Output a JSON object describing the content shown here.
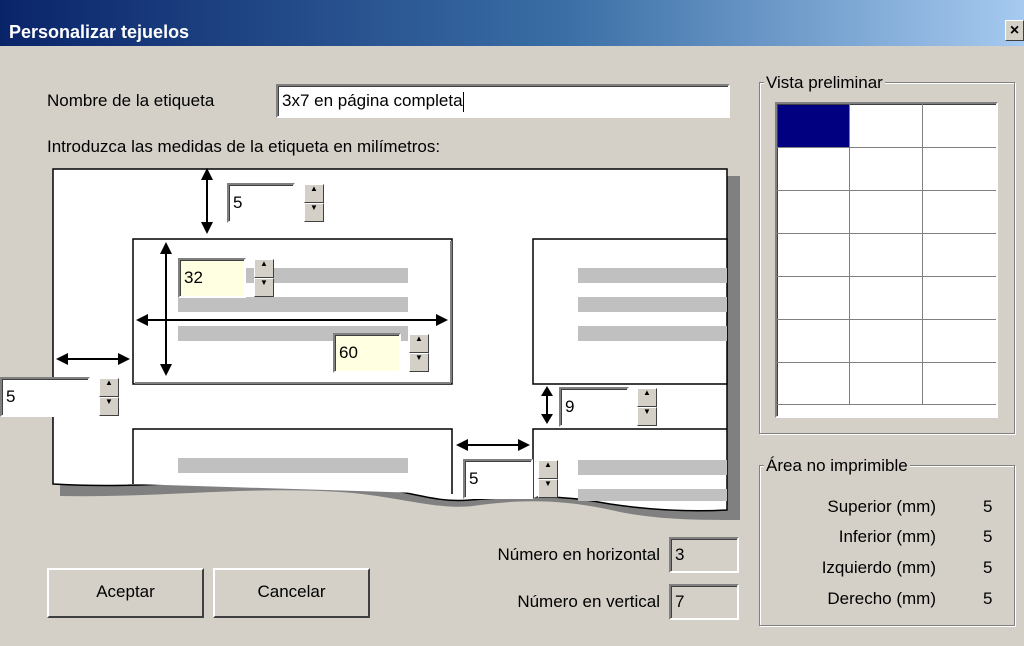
{
  "window": {
    "title": "Personalizar tejuelos",
    "close_glyph": "×"
  },
  "form": {
    "name_label": "Nombre de la etiqueta",
    "name_value": "3x7 en página completa",
    "measures_label": "Introduzca las medidas de la etiqueta en milímetros:"
  },
  "measures": {
    "top_margin": "5",
    "label_height": "32",
    "label_width": "60",
    "left_margin": "5",
    "vertical_gap": "9",
    "horizontal_gap": "5"
  },
  "counts": {
    "horizontal_label": "Número en horizontal",
    "horizontal_value": "3",
    "vertical_label": "Número en vertical",
    "vertical_value": "7"
  },
  "buttons": {
    "accept": "Aceptar",
    "cancel": "Cancelar"
  },
  "preview": {
    "title": "Vista preliminar",
    "columns": 3,
    "rows": 7,
    "selected_color": "#000080"
  },
  "non_printable": {
    "title": "Área no imprimible",
    "rows": [
      {
        "label": "Superior (mm)",
        "value": "5"
      },
      {
        "label": "Inferior (mm)",
        "value": "5"
      },
      {
        "label": "Izquierdo (mm)",
        "value": "5"
      },
      {
        "label": "Derecho (mm)",
        "value": "5"
      }
    ]
  },
  "icons": {
    "spin_up": "up-arrow-icon",
    "spin_down": "down-arrow-icon"
  }
}
